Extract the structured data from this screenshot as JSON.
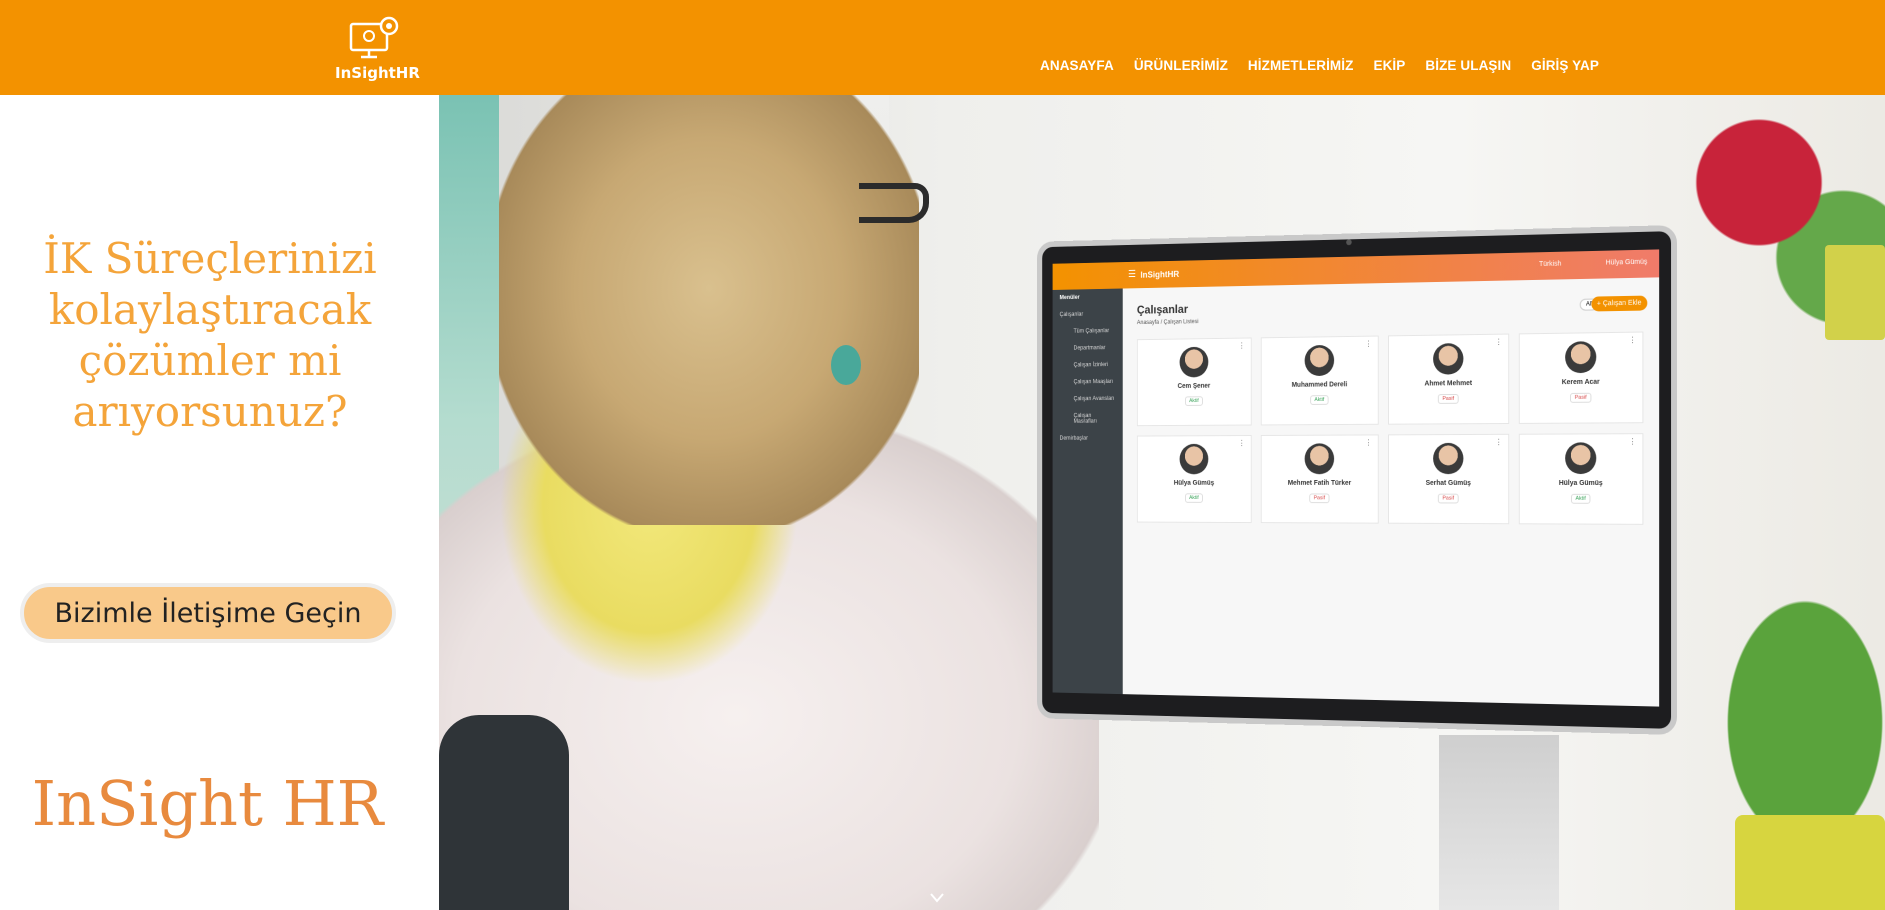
{
  "header": {
    "logo_text": "InSightHR",
    "nav": [
      "ANASAYFA",
      "ÜRÜNLERİMİZ",
      "HİZMETLERİMİZ",
      "EKİP",
      "BİZE ULAŞIN",
      "GİRİŞ YAP"
    ]
  },
  "hero": {
    "heading_lines": [
      "İK Süreçlerinizi",
      "kolaylaştıracak",
      "çözümler mi",
      "arıyorsunuz?"
    ],
    "cta_label": "Bizimle İletişime Geçin",
    "brand": "InSight HR"
  },
  "screen": {
    "app_title": "InSightHR",
    "language": "Türkish",
    "user": "Hülya Gümüş",
    "sidebar": {
      "section": "Menüler",
      "items": [
        "Çalışanlar",
        "Tüm Çalışanlar",
        "Departmanlar",
        "Çalışan İzinleri",
        "Çalışan Maaşları",
        "Çalışan Avansları",
        "Çalışan Masrafları",
        "Demirbaşlar"
      ]
    },
    "page_title": "Çalışanlar",
    "breadcrumb": [
      "Anasayfa",
      "Çalışan Listesi"
    ],
    "filter_label": "All",
    "add_button": "+ Çalışan Ekle",
    "employees": [
      {
        "name": "Cem Şener",
        "status": "Aktif",
        "state": "active"
      },
      {
        "name": "Muhammed Dereli",
        "status": "Aktif",
        "state": "active"
      },
      {
        "name": "Ahmet Mehmet",
        "status": "Pasif",
        "state": "passive"
      },
      {
        "name": "Kerem Acar",
        "status": "Pasif",
        "state": "passive"
      },
      {
        "name": "Hülya Gümüş",
        "status": "Aktif",
        "state": "active"
      },
      {
        "name": "Mehmet Fatih Türker",
        "status": "Pasif",
        "state": "passive"
      },
      {
        "name": "Serhat Gümüş",
        "status": "Pasif",
        "state": "passive"
      },
      {
        "name": "Hülya Gümüş",
        "status": "Aktif",
        "state": "active"
      }
    ]
  },
  "colors": {
    "header_bg": "#f39200",
    "heading": "#f4a43a",
    "cta_bg": "#f9c98a",
    "brand": "#e88a3e"
  }
}
